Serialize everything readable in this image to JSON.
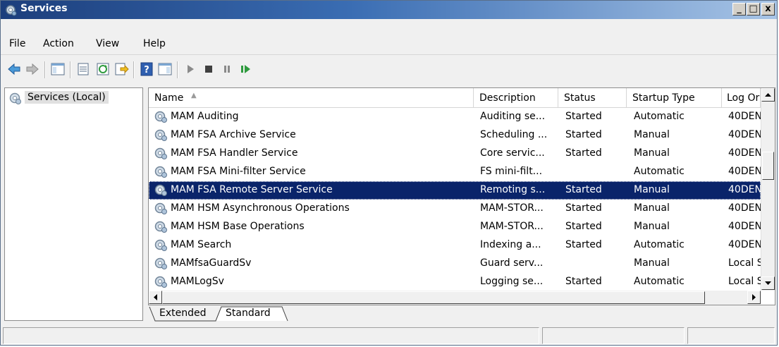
{
  "window": {
    "title": "Services",
    "controls": {
      "minimize": "_",
      "maximize": "□",
      "close": "x"
    }
  },
  "menu": {
    "items": [
      "File",
      "Action",
      "View",
      "Help"
    ]
  },
  "toolbar": {
    "buttons": [
      "back-icon",
      "forward-icon",
      "show-hide-console-tree-icon",
      "properties-icon",
      "refresh-icon",
      "export-list-icon",
      "help-icon",
      "show-hide-action-pane-icon",
      "start-service-icon",
      "stop-service-icon",
      "pause-service-icon",
      "restart-service-icon"
    ]
  },
  "tree": {
    "root_label": "Services (Local)"
  },
  "table": {
    "columns": [
      "Name",
      "Description",
      "Status",
      "Startup Type",
      "Log On As"
    ],
    "visible_column_labels": [
      "Name",
      "Description",
      "Status",
      "Startup Type",
      "Log Or"
    ],
    "sort_indicator": "▲",
    "rows": [
      {
        "name": "MAM Auditing",
        "description": "Auditing se...",
        "status": "Started",
        "startup": "Automatic",
        "logon": "40DEN"
      },
      {
        "name": "MAM FSA Archive Service",
        "description": "Scheduling ...",
        "status": "Started",
        "startup": "Manual",
        "logon": "40DEN"
      },
      {
        "name": "MAM FSA Handler Service",
        "description": "Core servic...",
        "status": "Started",
        "startup": "Manual",
        "logon": "40DEN"
      },
      {
        "name": "MAM FSA Mini-filter Service",
        "description": "FS mini-filt...",
        "status": "",
        "startup": "Automatic",
        "logon": "40DEN"
      },
      {
        "name": "MAM FSA Remote Server Service",
        "description": "Remoting s...",
        "status": "Started",
        "startup": "Manual",
        "logon": "40DEN",
        "selected": true
      },
      {
        "name": "MAM HSM Asynchronous Operations",
        "description": "MAM-STOR...",
        "status": "Started",
        "startup": "Manual",
        "logon": "40DEN"
      },
      {
        "name": "MAM HSM Base Operations",
        "description": "MAM-STOR...",
        "status": "Started",
        "startup": "Manual",
        "logon": "40DEN"
      },
      {
        "name": "MAM Search",
        "description": "Indexing a...",
        "status": "Started",
        "startup": "Automatic",
        "logon": "40DEN"
      },
      {
        "name": "MAMfsaGuardSv",
        "description": "Guard serv...",
        "status": "",
        "startup": "Manual",
        "logon": "Local S"
      },
      {
        "name": "MAMLogSv",
        "description": "Logging se...",
        "status": "Started",
        "startup": "Automatic",
        "logon": "Local S"
      }
    ]
  },
  "tabs": {
    "items": [
      "Extended",
      "Standard"
    ],
    "active": "Standard"
  },
  "colors": {
    "selection": "#0a246a",
    "title_start": "#1c3e7c",
    "title_end": "#a7c4e6"
  }
}
